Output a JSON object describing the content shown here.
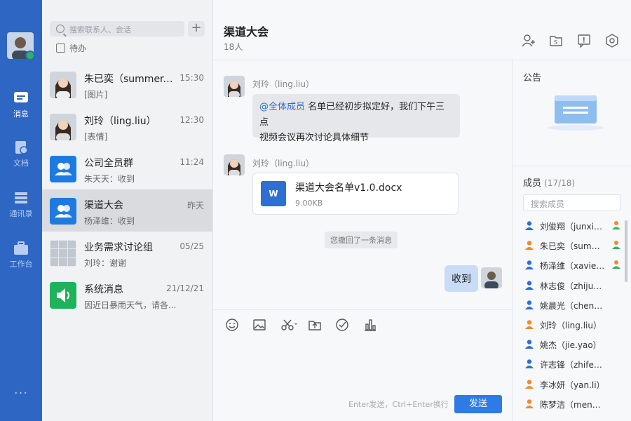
{
  "rail": {
    "items": [
      {
        "label": "消息",
        "icon": "message-icon"
      },
      {
        "label": "文档",
        "icon": "document-icon"
      },
      {
        "label": "通讯录",
        "icon": "contacts-icon"
      },
      {
        "label": "工作台",
        "icon": "workbench-icon"
      }
    ],
    "more": "···"
  },
  "sessions": {
    "search_placeholder": "搜索联系人、会话",
    "add": "+",
    "todo": "待办",
    "list": [
      {
        "name": "朱已奕（summer.z...",
        "time": "15:30",
        "preview": "[图片]"
      },
      {
        "name": "刘玲（ling.liu）",
        "time": "12:30",
        "preview": "[表情]"
      },
      {
        "name": "公司全员群",
        "time": "11:24",
        "preview": "朱天天：收到"
      },
      {
        "name": "渠道大会",
        "time": "昨天",
        "preview": "杨泽维：收到"
      },
      {
        "name": "业务需求讨论组",
        "time": "05/25",
        "preview": "刘玲：谢谢"
      },
      {
        "name": "系统消息",
        "time": "21/12/21",
        "preview": "因近日暴雨天气，请各..."
      }
    ]
  },
  "chat": {
    "title": "渠道大会",
    "count": "18人",
    "messages": [
      {
        "sender": "刘玲（ling.liu）",
        "mention": "@全体成员",
        "text": " 名单已经初步拟定好，我们下午三点",
        "text2": "视频会议再次讨论具体细节"
      },
      {
        "sender": "刘玲（ling.liu）",
        "file_name": "渠道大会名单v1.0.docx",
        "file_size": "9.00KB",
        "file_badge": "W"
      }
    ],
    "recall_tip": "您撤回了一条消息",
    "my_message": "收到",
    "hint": "Enter发送，Ctrl+Enter换行",
    "send": "发送"
  },
  "right": {
    "announcement": "公告",
    "members_title": "成员",
    "members_count": "(17/18)",
    "member_search_placeholder": "搜索成员",
    "members": [
      {
        "name": "刘俊翔（junxiang...",
        "color": "#2d6fd2",
        "admin": true
      },
      {
        "name": "朱已奕（summer.z...",
        "color": "#f08a2c",
        "admin": true
      },
      {
        "name": "杨泽维（xavier.y...",
        "color": "#2d6fd2",
        "admin": true
      },
      {
        "name": "林志俊（zhijun.lin）",
        "color": "#2d6fd2",
        "admin": false
      },
      {
        "name": "姚晨光（chenguang...",
        "color": "#2d6fd2",
        "admin": false
      },
      {
        "name": "刘玲（ling.liu）",
        "color": "#f08a2c",
        "admin": false
      },
      {
        "name": "姚杰（jie.yao）",
        "color": "#2d6fd2",
        "admin": false
      },
      {
        "name": "许志锋（zhifeng.xu...",
        "color": "#2d6fd2",
        "admin": false
      },
      {
        "name": "李冰妍（yan.li）",
        "color": "#f08a2c",
        "admin": false
      },
      {
        "name": "陈梦洁（mengjie...",
        "color": "#f08a2c",
        "admin": false
      }
    ]
  },
  "window": {
    "minimize": "—",
    "maximize": "☐",
    "close": "✕"
  }
}
